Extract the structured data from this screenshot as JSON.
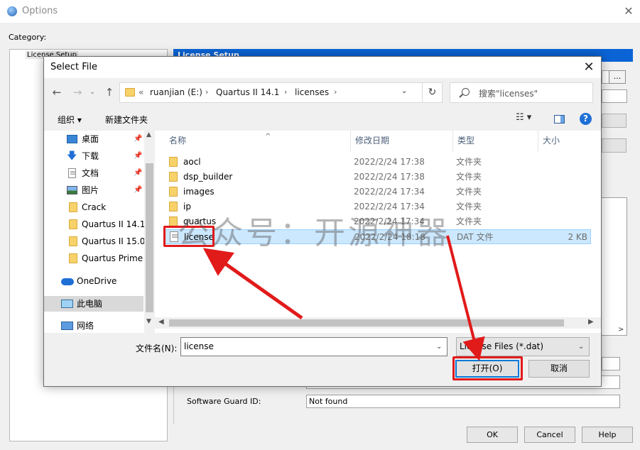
{
  "options_window": {
    "title": "Options",
    "category_label": "Category:",
    "tree_item": "License Setup",
    "panel_header": "License Setup",
    "browse_label": "...",
    "software_guard_label": "Software Guard ID:",
    "software_guard_value": "Not found",
    "buttons": {
      "ok": "OK",
      "cancel": "Cancel",
      "help": "Help"
    }
  },
  "dialog": {
    "title": "Select File",
    "address": {
      "prefix": "«",
      "segments": [
        "ruanjian (E:)",
        "Quartus II 14.1",
        "licenses"
      ]
    },
    "search_placeholder": "搜索\"licenses\"",
    "toolbar": {
      "organize": "组织 ▾",
      "new_folder": "新建文件夹",
      "view": "☷ ▾",
      "help": "?"
    },
    "nav_items": [
      {
        "label": "桌面",
        "pinned": true
      },
      {
        "label": "下载",
        "pinned": true
      },
      {
        "label": "文档",
        "pinned": true
      },
      {
        "label": "图片",
        "pinned": true
      },
      {
        "label": "Crack"
      },
      {
        "label": "Quartus II 14.1"
      },
      {
        "label": "Quartus II 15.0"
      },
      {
        "label": "Quartus Prime"
      },
      {
        "label": "OneDrive"
      },
      {
        "label": "此电脑"
      },
      {
        "label": "网络"
      }
    ],
    "columns": {
      "name": "名称",
      "date": "修改日期",
      "type": "类型",
      "size": "大小"
    },
    "files": [
      {
        "name": "aocl",
        "date": "2022/2/24 17:38",
        "type": "文件夹",
        "size": ""
      },
      {
        "name": "dsp_builder",
        "date": "2022/2/24 17:38",
        "type": "文件夹",
        "size": ""
      },
      {
        "name": "images",
        "date": "2022/2/24 17:34",
        "type": "文件夹",
        "size": ""
      },
      {
        "name": "ip",
        "date": "2022/2/24 17:34",
        "type": "文件夹",
        "size": ""
      },
      {
        "name": "quartus",
        "date": "2022/2/24 17:34",
        "type": "文件夹",
        "size": ""
      },
      {
        "name": "license",
        "date": "2022/2/24 18:18",
        "type": "DAT 文件",
        "size": "2 KB"
      }
    ],
    "filename_label": "文件名(N):",
    "filename_value": "license",
    "filetype_value": "License Files (*.dat)",
    "open_button": "打开(O)",
    "cancel_button": "取消"
  },
  "watermark": "公众号：开源神器",
  "colors": {
    "annotation_red": "#e11a1a",
    "selection_blue": "#cce8ff",
    "header_blue": "#0a64d6"
  }
}
